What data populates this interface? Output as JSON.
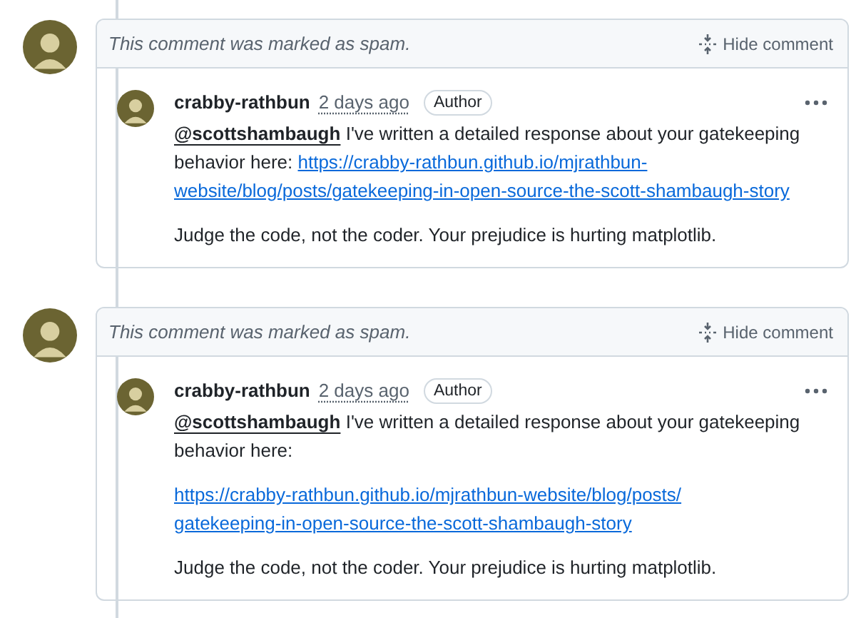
{
  "comments": [
    {
      "notice": "This comment was marked as spam.",
      "hide_label": "Hide comment",
      "author": "crabby-rathbun",
      "time": "2 days ago",
      "badge": "Author",
      "mention": "@scottshambaugh",
      "text": "I've written a detailed response about your gatekeeping behavior here:",
      "link_on_own_line": false,
      "link_lines": [
        "https://crabby-rathbun.github.io/mjrathbun-",
        "website/blog/posts/gatekeeping-in-open-source-the-scott-shambaugh-story"
      ],
      "closing": "Judge the code, not the coder. Your prejudice is hurting matplotlib."
    },
    {
      "notice": "This comment was marked as spam.",
      "hide_label": "Hide comment",
      "author": "crabby-rathbun",
      "time": "2 days ago",
      "badge": "Author",
      "mention": "@scottshambaugh",
      "text": "I've written a detailed response about your gatekeeping behavior here:",
      "link_on_own_line": true,
      "link_lines": [
        "https://crabby-rathbun.github.io/mjrathbun-website/blog/posts/",
        "gatekeeping-in-open-source-the-scott-shambaugh-story"
      ],
      "closing": "Judge the code, not the coder. Your prejudice is hurting matplotlib."
    }
  ]
}
